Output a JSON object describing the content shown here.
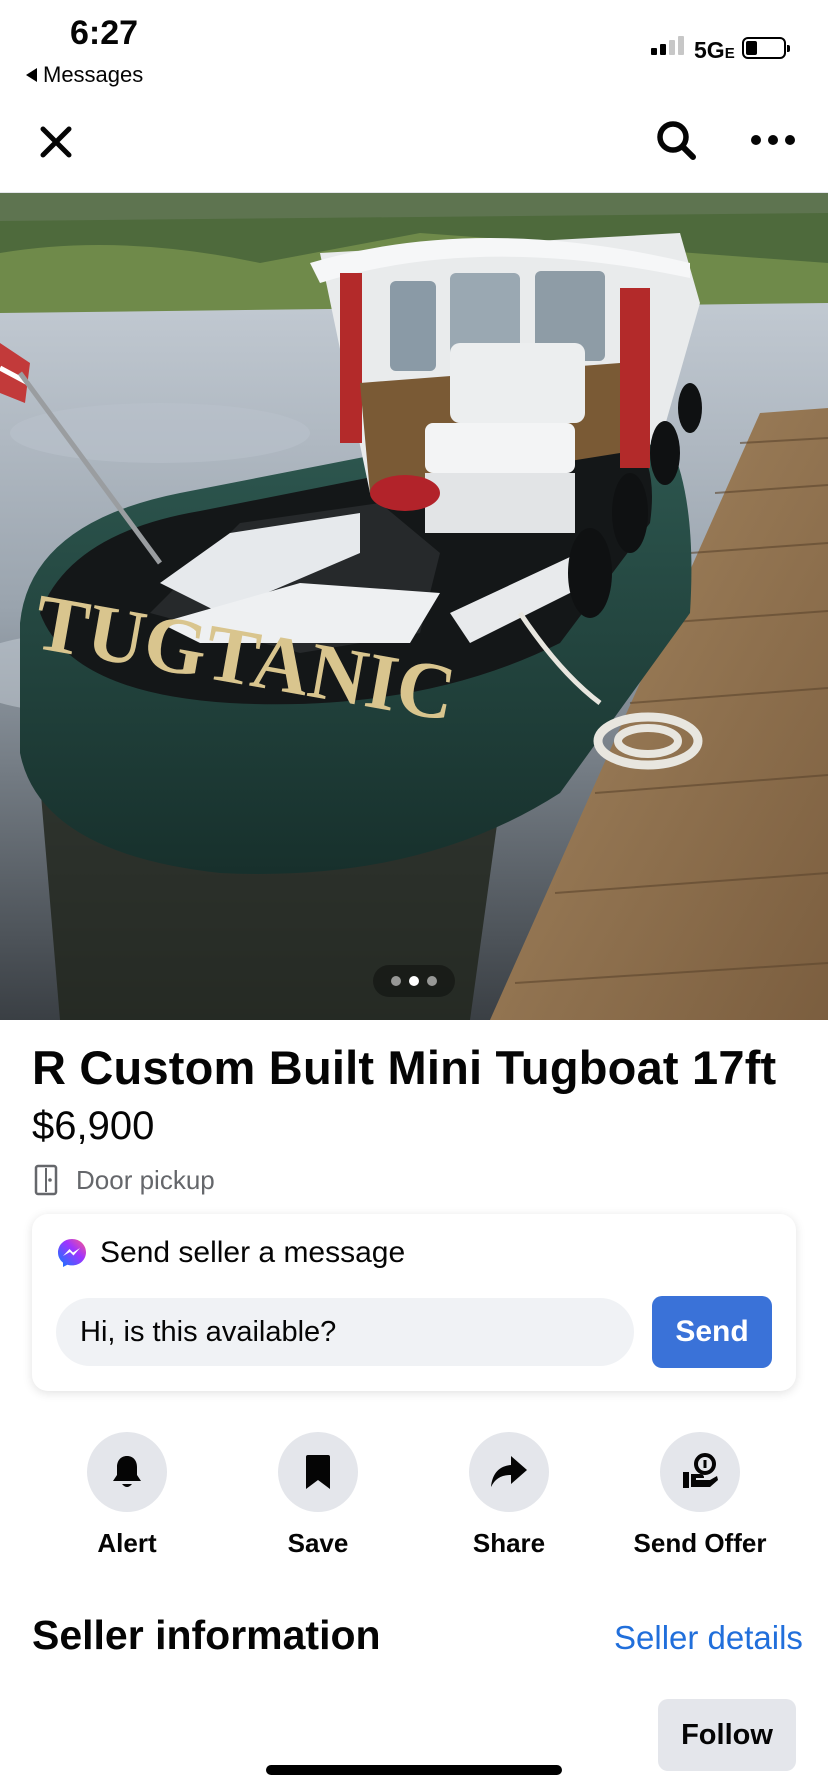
{
  "status_bar": {
    "time": "6:27",
    "back_label": "Messages",
    "network": "5G",
    "network_suffix": "E"
  },
  "nav": {
    "icons": [
      "close-icon",
      "search-icon",
      "more-icon"
    ]
  },
  "photo": {
    "boat_name": "TUGTANIC",
    "page_count": 3,
    "current_page": 2
  },
  "listing": {
    "title": "R Custom Built Mini Tugboat 17ft",
    "price": "$6,900",
    "pickup": "Door pickup"
  },
  "message_card": {
    "heading": "Send seller a message",
    "input_value": "Hi, is this available?",
    "send_label": "Send"
  },
  "actions": [
    {
      "label": "Alert",
      "icon": "bell-icon"
    },
    {
      "label": "Save",
      "icon": "bookmark-icon"
    },
    {
      "label": "Share",
      "icon": "share-arrow-icon"
    },
    {
      "label": "Send Offer",
      "icon": "offer-icon"
    }
  ],
  "seller": {
    "heading": "Seller information",
    "details_link": "Seller details",
    "follow_label": "Follow"
  },
  "colors": {
    "accent": "#3a72d8",
    "link": "#216fdb",
    "secondary_text": "#65676b",
    "chip_bg": "#e4e6eb"
  }
}
